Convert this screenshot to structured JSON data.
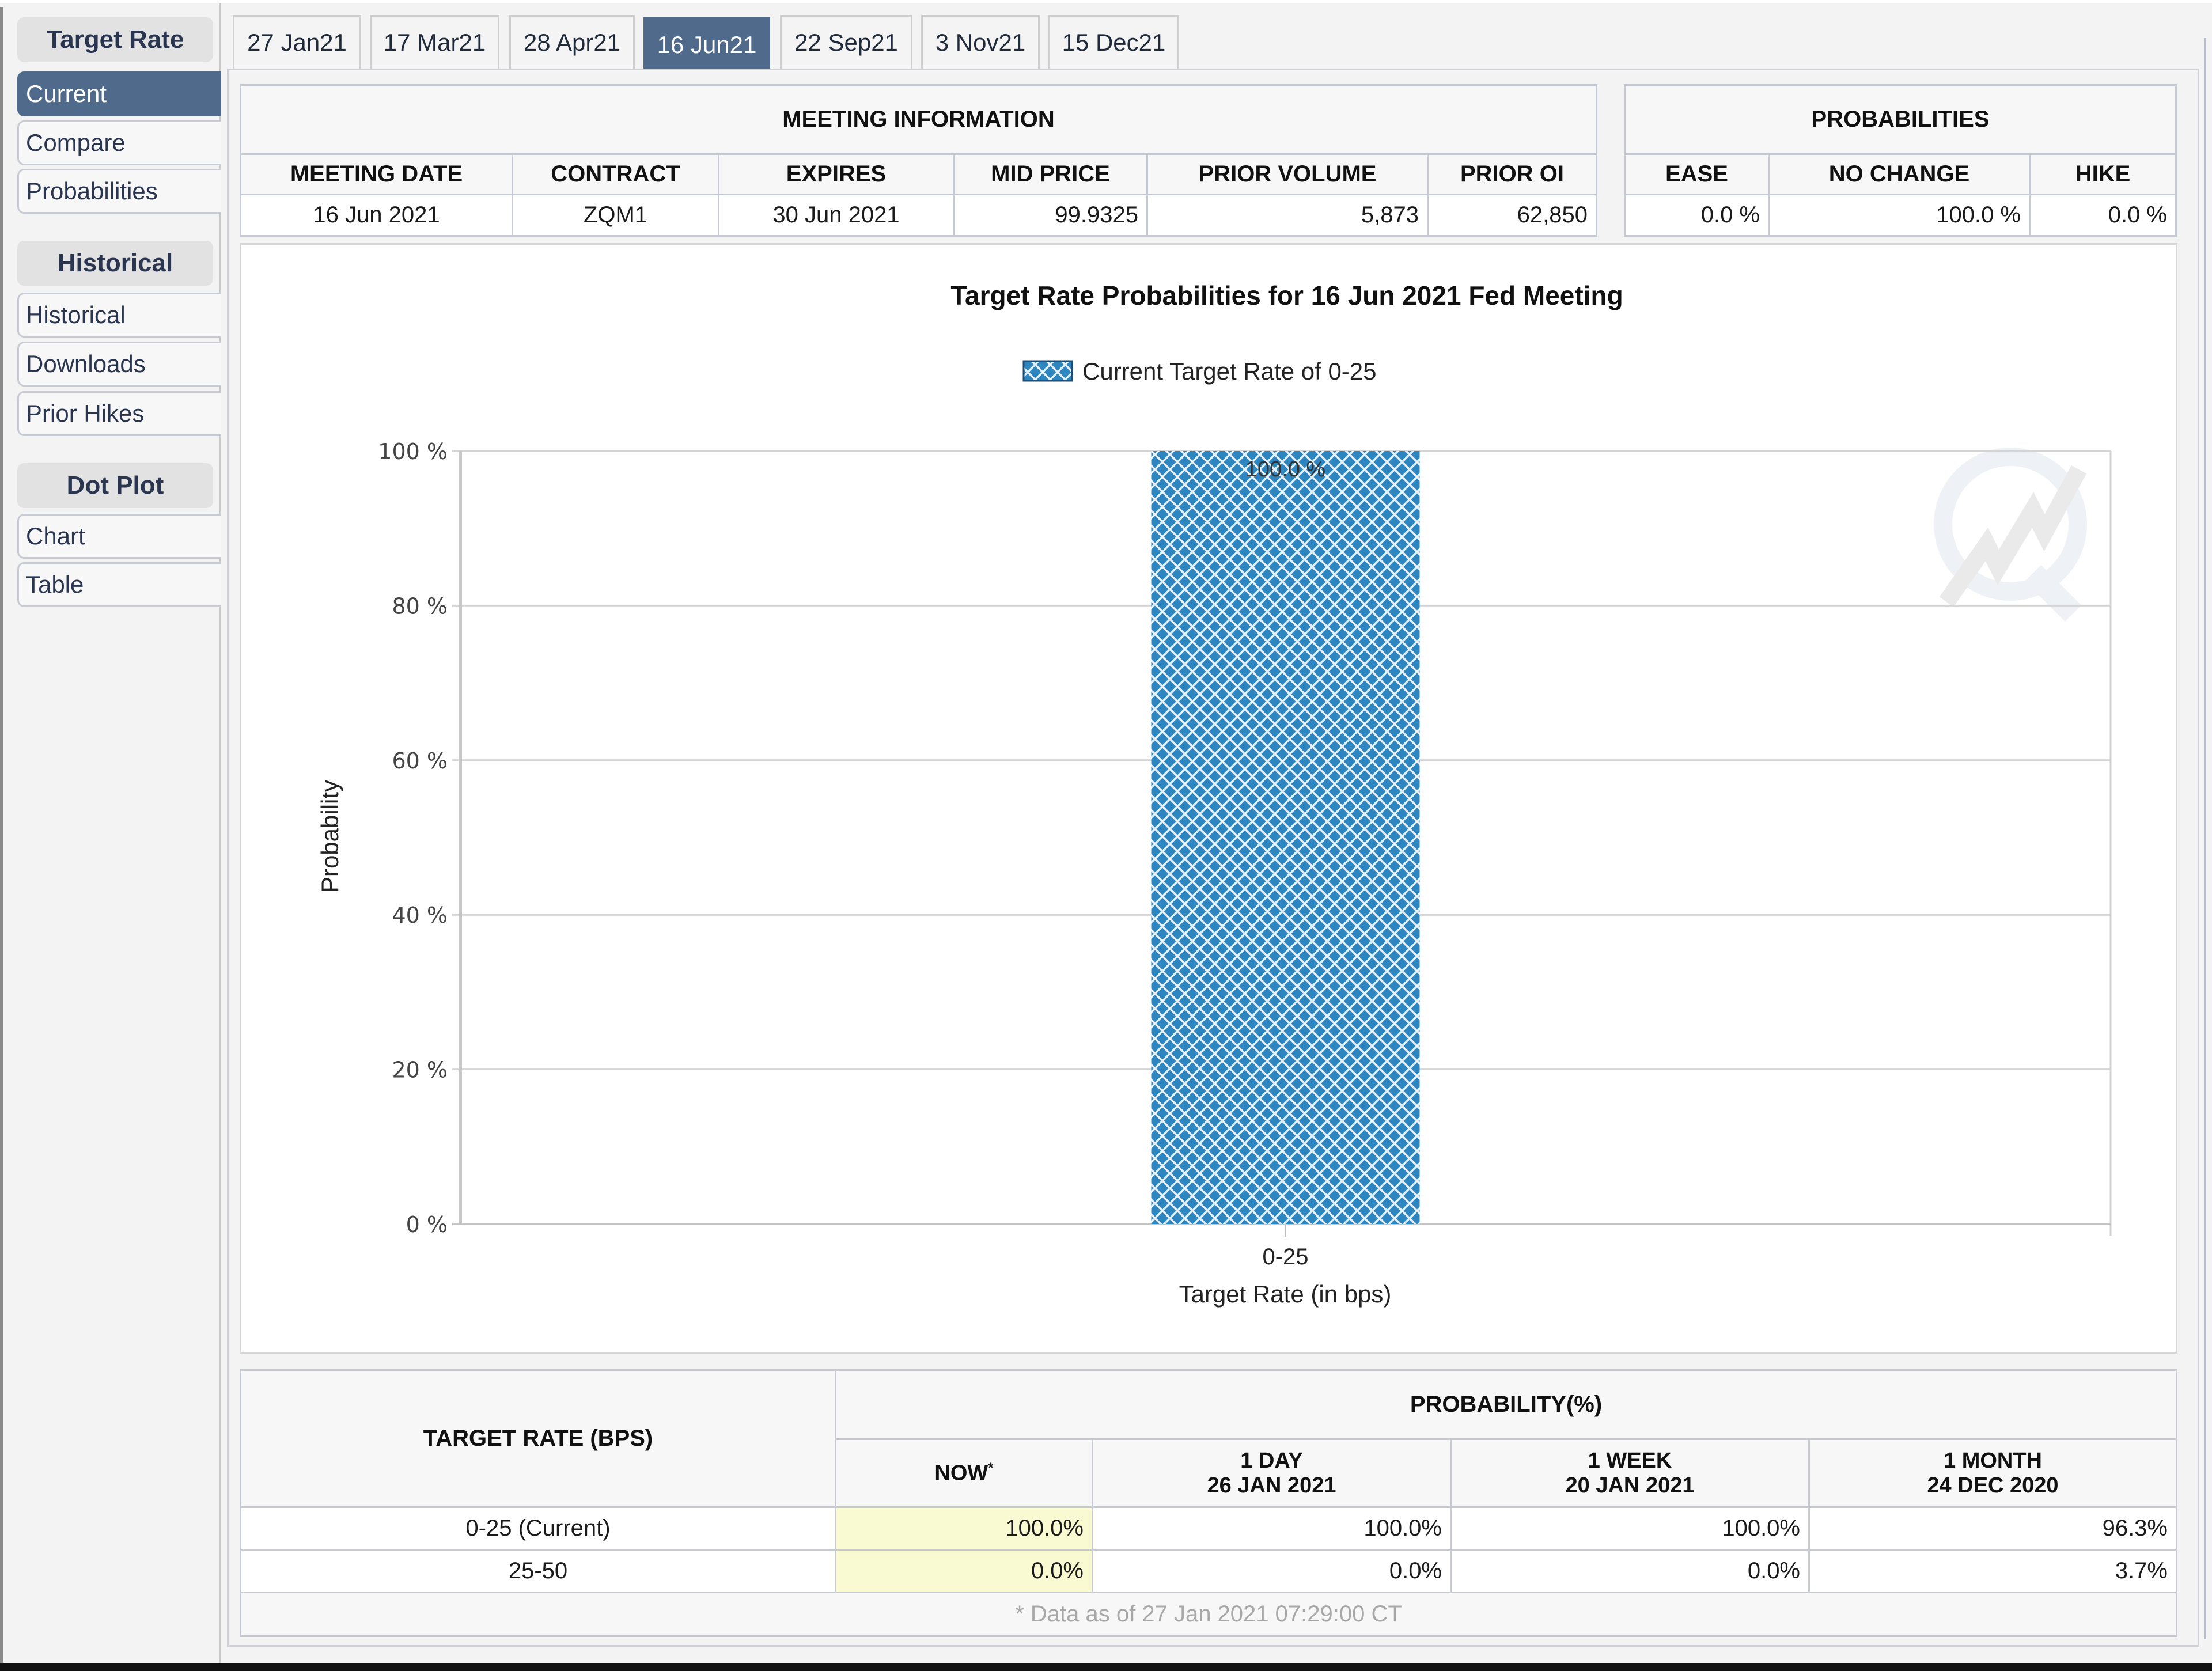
{
  "sidebar": {
    "groups": [
      {
        "title": "Target Rate",
        "items": [
          {
            "label": "Current",
            "active": true
          },
          {
            "label": "Compare"
          },
          {
            "label": "Probabilities"
          }
        ]
      },
      {
        "title": "Historical",
        "items": [
          {
            "label": "Historical"
          },
          {
            "label": "Downloads"
          },
          {
            "label": "Prior Hikes"
          }
        ]
      },
      {
        "title": "Dot Plot",
        "items": [
          {
            "label": "Chart"
          },
          {
            "label": "Table"
          }
        ]
      }
    ]
  },
  "tabs": [
    {
      "label": "27 Jan21"
    },
    {
      "label": "17 Mar21"
    },
    {
      "label": "28 Apr21"
    },
    {
      "label": "16 Jun21",
      "active": true
    },
    {
      "label": "22 Sep21"
    },
    {
      "label": "3 Nov21"
    },
    {
      "label": "15 Dec21"
    }
  ],
  "meeting_info": {
    "title": "MEETING INFORMATION",
    "headers": [
      "MEETING DATE",
      "CONTRACT",
      "EXPIRES",
      "MID PRICE",
      "PRIOR VOLUME",
      "PRIOR OI"
    ],
    "values": [
      "16 Jun 2021",
      "ZQM1",
      "30 Jun 2021",
      "99.9325",
      "5,873",
      "62,850"
    ]
  },
  "probabilities": {
    "title": "PROBABILITIES",
    "headers": [
      "EASE",
      "NO CHANGE",
      "HIKE"
    ],
    "values": [
      "0.0 %",
      "100.0 %",
      "0.0 %"
    ]
  },
  "chart_data": {
    "type": "bar",
    "title": "Target Rate Probabilities for 16 Jun 2021 Fed Meeting",
    "legend": [
      {
        "label": "Current Target Rate of 0-25",
        "color": "#2e86c1",
        "pattern": "crosshatch"
      }
    ],
    "legend_position": "top-center",
    "categories": [
      "0-25"
    ],
    "values": [
      100.0
    ],
    "data_labels": [
      "100.0 %"
    ],
    "xlabel": "Target Rate (in bps)",
    "ylabel": "Probability",
    "ylim": [
      0,
      100
    ],
    "yticks": [
      0,
      20,
      40,
      60,
      80,
      100
    ],
    "ytick_labels": [
      "0 %",
      "20 %",
      "40 %",
      "60 %",
      "80 %",
      "100 %"
    ],
    "grid": true,
    "bar_color": "#2e86c1"
  },
  "history": {
    "row_header": "TARGET RATE (BPS)",
    "group_header": "PROBABILITY(%)",
    "columns": [
      {
        "line1": "NOW",
        "mark": "*"
      },
      {
        "line1": "1 DAY",
        "line2": "26 JAN 2021"
      },
      {
        "line1": "1 WEEK",
        "line2": "20 JAN 2021"
      },
      {
        "line1": "1 MONTH",
        "line2": "24 DEC 2020"
      }
    ],
    "rows": [
      {
        "rate": "0-25 (Current)",
        "values": [
          "100.0%",
          "100.0%",
          "100.0%",
          "96.3%"
        ]
      },
      {
        "rate": "25-50",
        "values": [
          "0.0%",
          "0.0%",
          "0.0%",
          "3.7%"
        ]
      }
    ],
    "footnote": "* Data as of 27 Jan 2021 07:29:00 CT"
  }
}
